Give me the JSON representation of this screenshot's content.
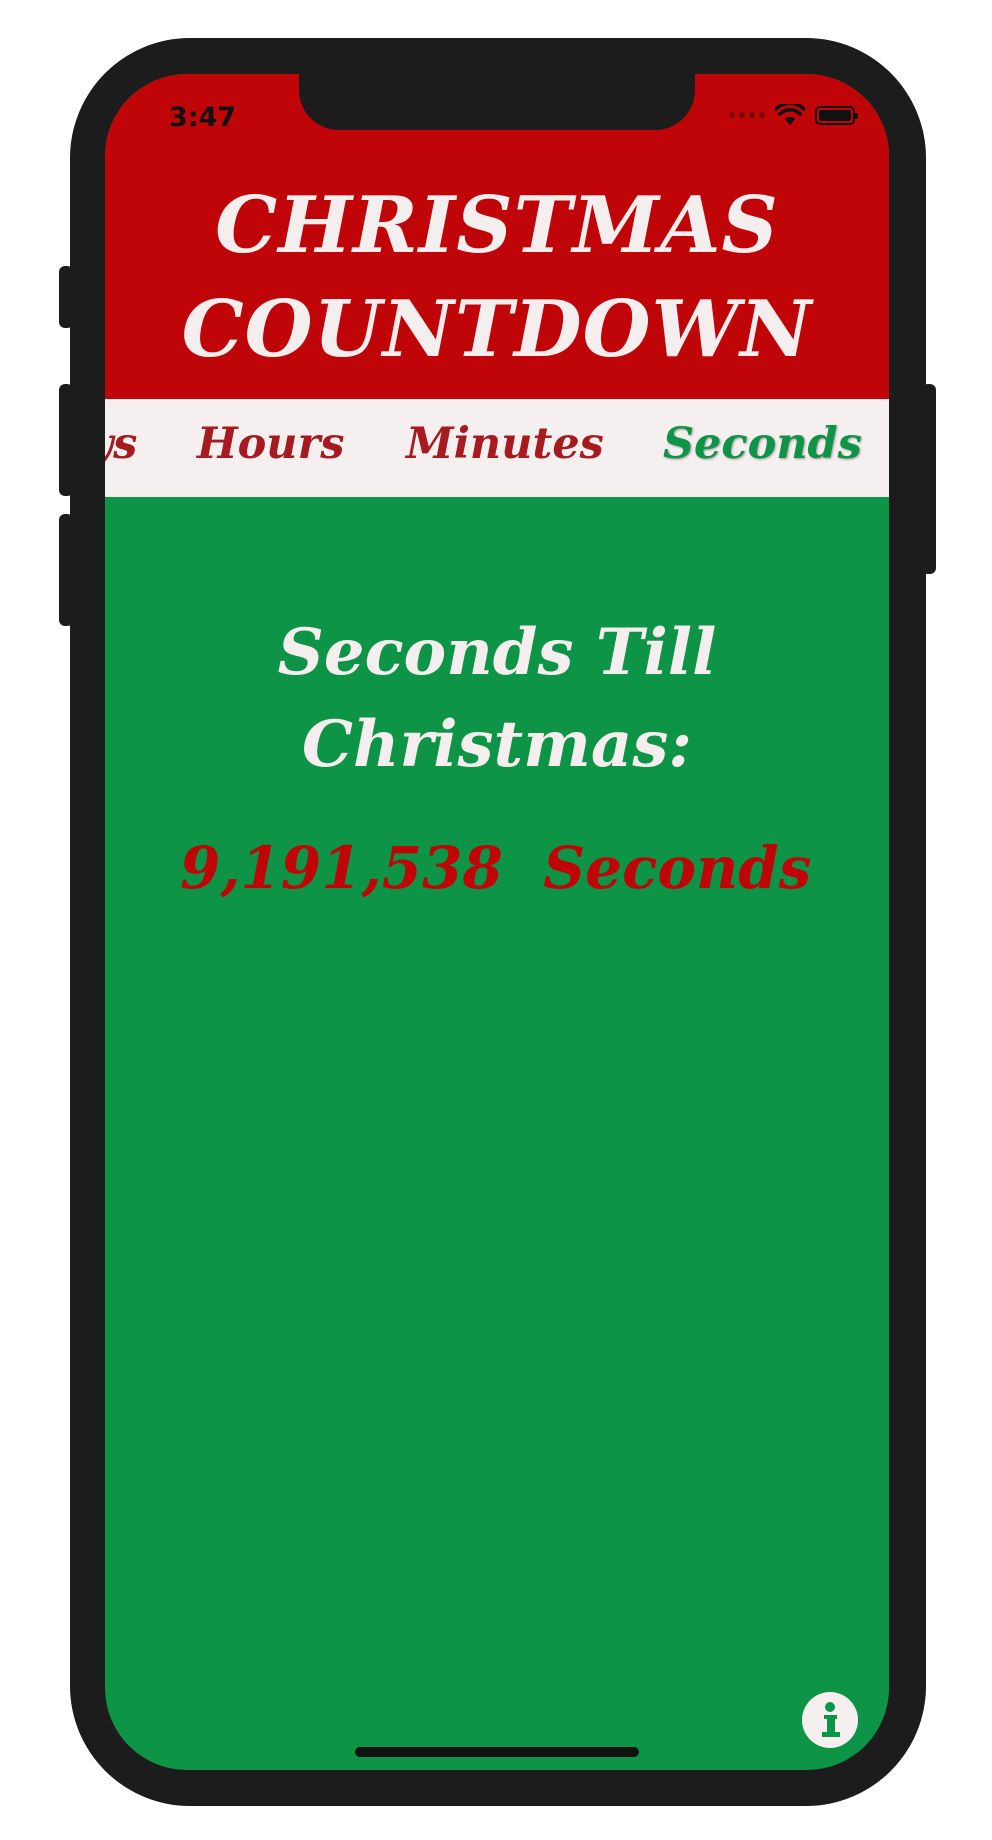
{
  "status_bar": {
    "time": "3:47"
  },
  "header": {
    "title_line1": "CHRISTMAS",
    "title_line2": "COUNTDOWN"
  },
  "tabs": [
    {
      "label": "Days",
      "active": false
    },
    {
      "label": "Hours",
      "active": false
    },
    {
      "label": "Minutes",
      "active": false
    },
    {
      "label": "Seconds",
      "active": true
    }
  ],
  "countdown": {
    "title_line1": "Seconds Till",
    "title_line2": "Christmas:",
    "value": "9,191,538",
    "unit": "Seconds"
  },
  "colors": {
    "header_red": "#c00509",
    "background_green": "#0d9446",
    "tab_bar": "#f6efef",
    "tab_text": "#a51b1f",
    "active_tab_text": "#0d9446",
    "value_red": "#c00509"
  },
  "icons": {
    "info": "info-icon",
    "wifi": "wifi-icon",
    "battery": "battery-icon"
  }
}
